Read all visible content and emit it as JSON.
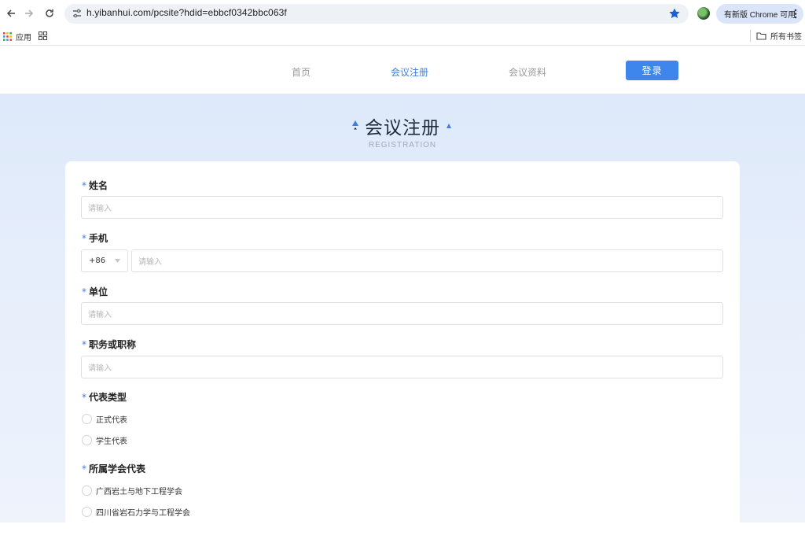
{
  "browser": {
    "url": "h.yibanhui.com/pcsite?hdid=ebbcf0342bbc063f",
    "update_label": "有新版 Chrome 可用",
    "bookmarks": {
      "apps_label": "应用",
      "all_bookmarks_label": "所有书签"
    }
  },
  "site_nav": {
    "items": [
      {
        "label": "首页"
      },
      {
        "label": "会议注册"
      },
      {
        "label": "会议资料"
      }
    ],
    "login_label": "登录",
    "accent_color": "#3f86ec"
  },
  "hero": {
    "title": "会议注册",
    "subtitle": "REGISTRATION"
  },
  "form": {
    "name": {
      "label": "姓名",
      "placeholder": "请输入"
    },
    "phone": {
      "label": "手机",
      "country_code": "+86",
      "placeholder": "请输入"
    },
    "org": {
      "label": "单位",
      "placeholder": "请输入"
    },
    "title": {
      "label": "职务或职称",
      "placeholder": "请输入"
    },
    "rep_type": {
      "label": "代表类型",
      "options": [
        {
          "label": "正式代表"
        },
        {
          "label": "学生代表"
        }
      ]
    },
    "society": {
      "label": "所属学会代表",
      "options": [
        {
          "label": "广西岩土与地下工程学会"
        },
        {
          "label": "四川省岩石力学与工程学会"
        }
      ]
    },
    "required_mark": "*"
  }
}
